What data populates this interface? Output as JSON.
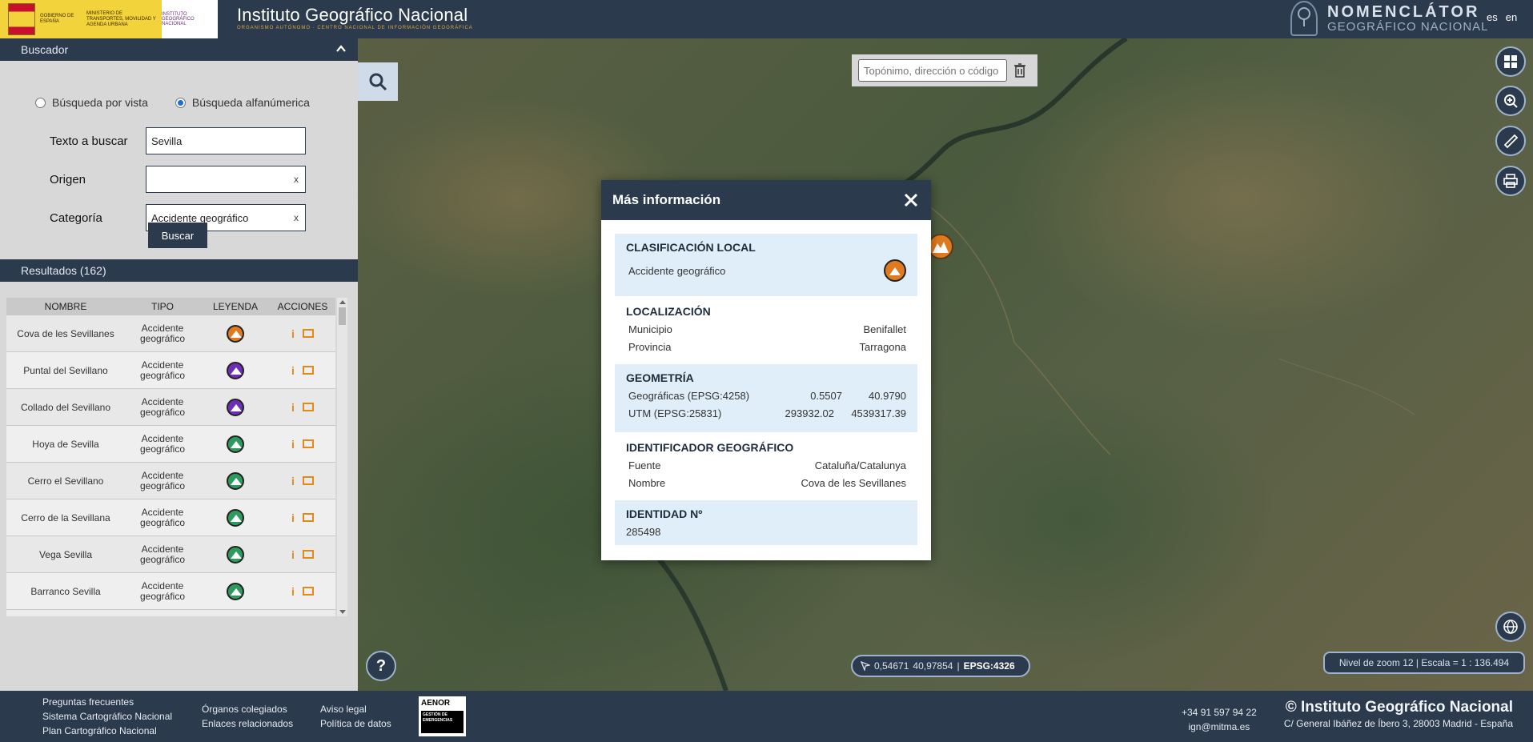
{
  "header": {
    "gov_text": "GOBIERNO DE ESPAÑA",
    "ministry_text": "MINISTERIO DE TRANSPORTES, MOVILIDAD Y AGENDA URBANA",
    "ign_small": "INSTITUTO GEOGRÁFICO NACIONAL",
    "ign_name": "Instituto Geográfico Nacional",
    "ign_sub": "ORGANISMO AUTÓNOMO · CENTRO NACIONAL DE INFORMACIÓN GEOGRÁFICA",
    "app_title_1": "NOMENCLÁTOR",
    "app_title_2": "GEOGRÁFICO NACIONAL",
    "lang_es": "es",
    "lang_en": "en"
  },
  "search_panel": {
    "title": "Buscador",
    "radio_vista": "Búsqueda por vista",
    "radio_alfa": "Búsqueda alfanúmerica",
    "selected_mode": "alfa",
    "texto_label": "Texto a buscar",
    "texto_value": "Sevilla",
    "origen_label": "Origen",
    "origen_value": "",
    "origen_clear": "x",
    "categoria_label": "Categoría",
    "categoria_value": "Accidente geográfico",
    "categoria_clear": "x",
    "buscar_label": "Buscar"
  },
  "results": {
    "title": "Resultados (162)",
    "columns": [
      "NOMBRE",
      "TIPO",
      "LEYENDA",
      "ACCIONES"
    ],
    "rows": [
      {
        "nombre": "Cova de les Sevillanes",
        "tipo1": "Accidente",
        "tipo2": "geográfico",
        "legend": "orange"
      },
      {
        "nombre": "Puntal del Sevillano",
        "tipo1": "Accidente",
        "tipo2": "geográfico",
        "legend": "purple"
      },
      {
        "nombre": "Collado del Sevillano",
        "tipo1": "Accidente",
        "tipo2": "geográfico",
        "legend": "purple"
      },
      {
        "nombre": "Hoya de Sevilla",
        "tipo1": "Accidente",
        "tipo2": "geográfico",
        "legend": "green"
      },
      {
        "nombre": "Cerro el Sevillano",
        "tipo1": "Accidente",
        "tipo2": "geográfico",
        "legend": "green"
      },
      {
        "nombre": "Cerro de la Sevillana",
        "tipo1": "Accidente",
        "tipo2": "geográfico",
        "legend": "green"
      },
      {
        "nombre": "Vega Sevilla",
        "tipo1": "Accidente",
        "tipo2": "geográfico",
        "legend": "green"
      },
      {
        "nombre": "Barranco Sevilla",
        "tipo1": "Accidente",
        "tipo2": "geográfico",
        "legend": "green"
      }
    ],
    "info_glyph": "i"
  },
  "map": {
    "search_placeholder": "Topónimo, dirección o código",
    "coords_x": "0,54671",
    "coords_y": "40,97854",
    "coords_epsg": "EPSG:4326",
    "zoom_text": "Nivel de zoom 12 | Escala = 1 : 136.494",
    "help_glyph": "?"
  },
  "modal": {
    "title": "Más información",
    "clasificacion_title": "CLASIFICACIÓN LOCAL",
    "clasificacion_value": "Accidente geográfico",
    "localizacion_title": "LOCALIZACIÓN",
    "municipio_label": "Municipio",
    "municipio_value": "Benifallet",
    "provincia_label": "Provincia",
    "provincia_value": "Tarragona",
    "geometria_title": "GEOMETRÍA",
    "geo_label": "Geográficas (EPSG:4258)",
    "geo_x": "0.5507",
    "geo_y": "40.9790",
    "utm_label": "UTM (EPSG:25831)",
    "utm_x": "293932.02",
    "utm_y": "4539317.39",
    "identificador_title": "IDENTIFICADOR GEOGRÁFICO",
    "fuente_label": "Fuente",
    "fuente_value": "Cataluña/Catalunya",
    "nombre_label": "Nombre",
    "nombre_value": "Cova de les Sevillanes",
    "identidad_title": "IDENTIDAD Nº",
    "identidad_value": "285498"
  },
  "footer": {
    "link_faq": "Preguntas frecuentes",
    "link_sistema": "Sistema Cartográfico Nacional",
    "link_plan": "Plan Cartográfico Nacional",
    "link_organos": "Órganos colegiados",
    "link_enlaces": "Enlaces relacionados",
    "link_aviso": "Aviso legal",
    "link_politica": "Política de datos",
    "aenor": "AENOR",
    "aenor_sub": "GESTIÓN DE EMERGENCIAS",
    "phone": "+34 91 597 94 22",
    "email": "ign@mitma.es",
    "copyright": "© Instituto Geográfico Nacional",
    "address": "C/ General Ibáñez de Íbero 3, 28003 Madrid - España"
  }
}
